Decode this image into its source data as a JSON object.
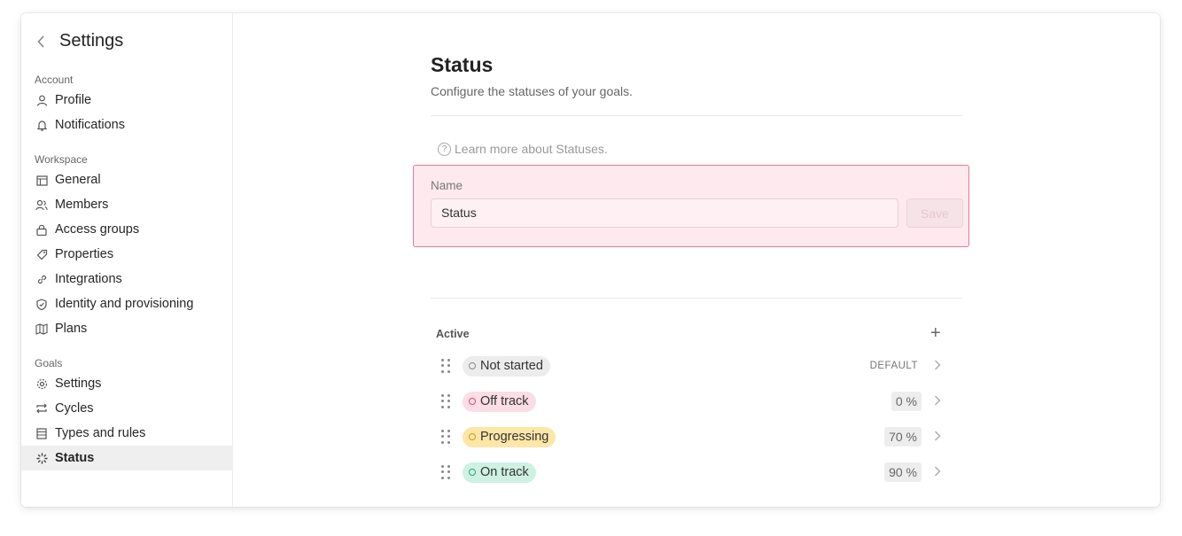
{
  "sidebar": {
    "title": "Settings",
    "groups": [
      {
        "label": "Account",
        "items": [
          {
            "label": "Profile",
            "icon": "person-icon"
          },
          {
            "label": "Notifications",
            "icon": "bell-icon"
          }
        ]
      },
      {
        "label": "Workspace",
        "items": [
          {
            "label": "General",
            "icon": "building-icon"
          },
          {
            "label": "Members",
            "icon": "members-icon"
          },
          {
            "label": "Access groups",
            "icon": "lock-icon"
          },
          {
            "label": "Properties",
            "icon": "tag-icon"
          },
          {
            "label": "Integrations",
            "icon": "link-icon"
          },
          {
            "label": "Identity and provisioning",
            "icon": "shield-icon"
          },
          {
            "label": "Plans",
            "icon": "map-icon"
          }
        ]
      },
      {
        "label": "Goals",
        "items": [
          {
            "label": "Settings",
            "icon": "gear-icon"
          },
          {
            "label": "Cycles",
            "icon": "cycle-icon"
          },
          {
            "label": "Types and rules",
            "icon": "list-icon"
          },
          {
            "label": "Status",
            "icon": "status-icon",
            "active": true
          }
        ]
      }
    ]
  },
  "main": {
    "title": "Status",
    "subtitle": "Configure the statuses of your goals.",
    "learn_more": "Learn more about Statuses.",
    "name_field": {
      "label": "Name",
      "value": "Status"
    },
    "save_label": "Save",
    "active_section": {
      "label": "Active",
      "statuses": [
        {
          "label": "Not started",
          "badge": "DEFAULT",
          "color": "#8a8a8a",
          "bg": "#ececec"
        },
        {
          "label": "Off track",
          "badge": "0 %",
          "color": "#d9486e",
          "bg": "#fbdde5"
        },
        {
          "label": "Progressing",
          "badge": "70 %",
          "color": "#d49a12",
          "bg": "#fde6a8"
        },
        {
          "label": "On track",
          "badge": "90 %",
          "color": "#2aa57a",
          "bg": "#cdf1e3"
        }
      ]
    }
  }
}
